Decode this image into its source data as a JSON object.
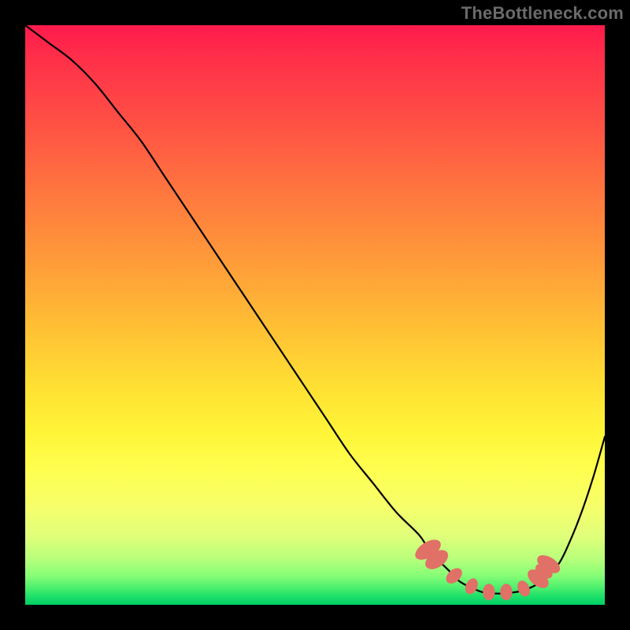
{
  "watermark": "TheBottleneck.com",
  "colors": {
    "marker_fill": "#e17067",
    "curve_stroke": "#000000"
  },
  "chart_data": {
    "type": "line",
    "title": "",
    "xlabel": "",
    "ylabel": "",
    "xlim": [
      0,
      100
    ],
    "ylim": [
      0,
      100
    ],
    "grid": false,
    "legend": false,
    "series": [
      {
        "name": "bottleneck-curve",
        "x": [
          0,
          4,
          8,
          12,
          16,
          20,
          24,
          28,
          32,
          36,
          40,
          44,
          48,
          52,
          56,
          60,
          64,
          68,
          70,
          73,
          75,
          78,
          80,
          83,
          86,
          89,
          92,
          94,
          96,
          98,
          100
        ],
        "y": [
          100,
          97,
          94,
          90,
          85,
          80,
          74,
          68,
          62,
          56,
          50,
          44,
          38,
          32,
          26,
          21,
          16,
          12,
          9,
          6,
          4,
          2.5,
          2,
          2,
          2.5,
          4,
          7,
          11,
          16,
          22,
          29
        ]
      }
    ],
    "markers": {
      "name": "highlight-points",
      "x": [
        69.5,
        71,
        74,
        77,
        80,
        83,
        86,
        88.5,
        89.5,
        90.3
      ],
      "y": [
        9.5,
        7.8,
        5.0,
        3.2,
        2.2,
        2.2,
        2.8,
        4.5,
        5.8,
        7.0
      ],
      "rx": [
        2.4,
        2.4,
        1.9,
        1.8,
        1.9,
        1.9,
        1.8,
        2.2,
        1.9,
        2.2
      ],
      "ry": [
        4.5,
        4.0,
        2.9,
        2.6,
        2.6,
        2.6,
        2.6,
        3.8,
        3.0,
        4.0
      ],
      "rot": [
        58,
        56,
        48,
        25,
        0,
        0,
        -25,
        -52,
        -55,
        -58
      ]
    }
  }
}
